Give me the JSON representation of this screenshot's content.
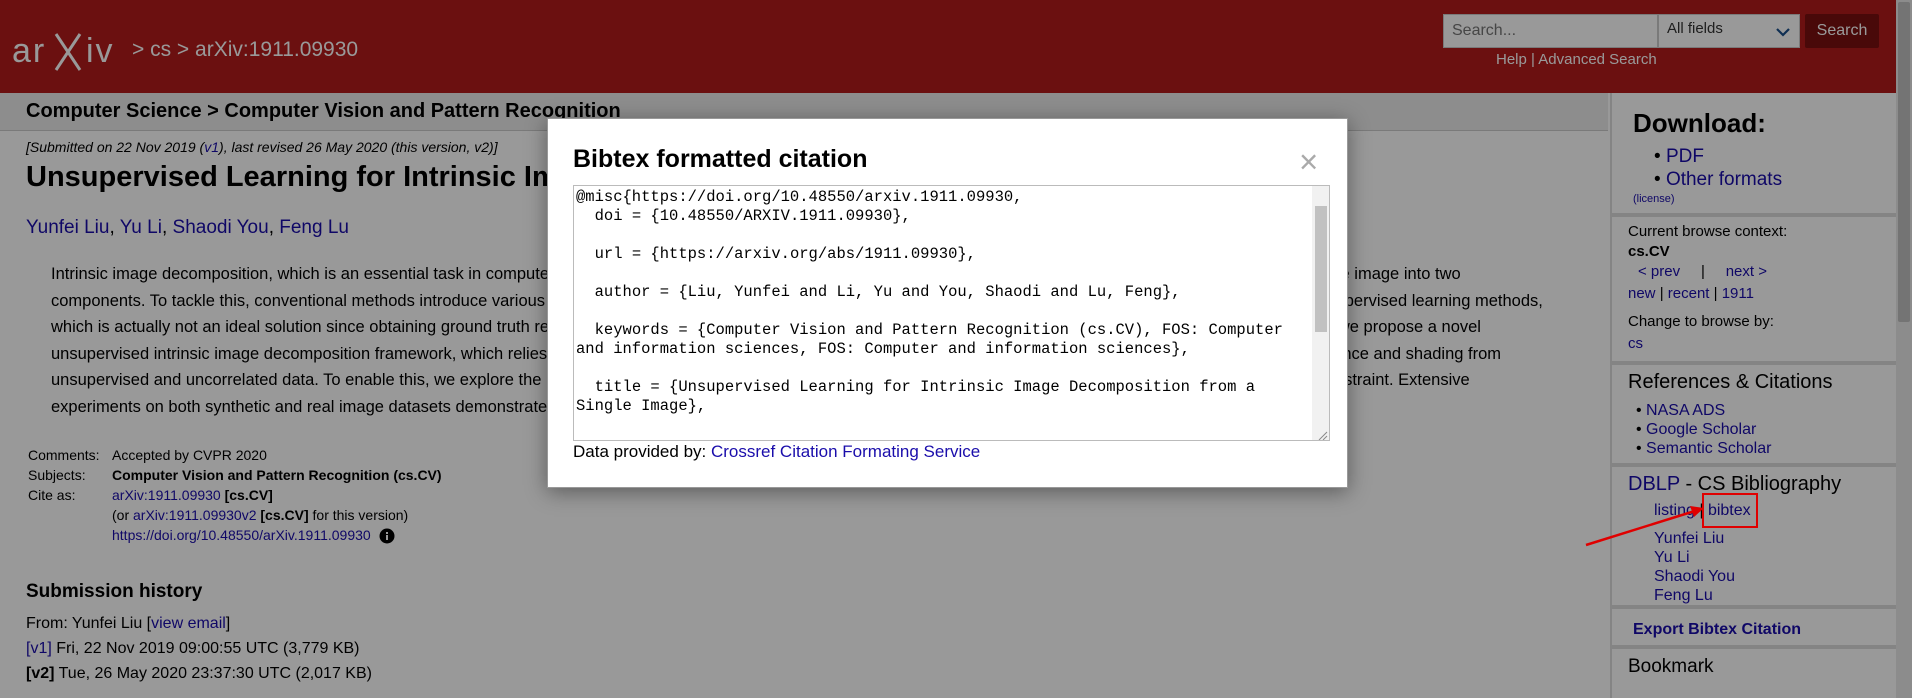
{
  "header": {
    "logo_text": "arXiv",
    "breadcrumb": "> cs > arXiv:1911.09930",
    "search": {
      "placeholder": "Search...",
      "field": "All fields",
      "button": "Search"
    },
    "links": {
      "help": "Help",
      "sep": "|",
      "advanced": "Advanced Search"
    }
  },
  "main": {
    "subject_heading": "Computer Science > Computer Vision and Pattern Recognition",
    "dateline": {
      "pre": "[Submitted on 22 Nov 2019 (",
      "v1": "v1",
      "post": "), last revised 26 May 2020 (this version, v2)]"
    },
    "title": "Unsupervised Learning for Intrinsic Image Decomposition from a Single Image",
    "authors": [
      "Yunfei Liu",
      "Yu Li",
      "Shaodi You",
      "Feng Lu"
    ],
    "author_sep": ", ",
    "abstract": "Intrinsic image decomposition, which is an essential task in computer vision, aims to infer the reflectance and shading of the scene. It is challenging since it needs to separate one image into two components. To tackle this, conventional methods introduce various priors to constrain the solution, yet with limited performance. Meanwhile, the problem is typically solved by supervised learning methods, which is actually not an ideal solution since obtaining ground truth reflectance and shading for massive general natural scenes is challenging and even impossible. In this paper, we propose a novel unsupervised intrinsic image decomposition framework, which relies on neither labeled training data nor hand-crafted priors. Instead, it directly learns the latent feature of reflectance and shading from unsupervised and uncorrelated data. To enable this, we explore the independence between reflectance and shading, the domain invariant content constraint and the physical constraint. Extensive experiments on both synthetic and real image datasets demonstrate consistently superior performance of the proposed method.",
    "meta": {
      "comments_key": "Comments:",
      "comments": "Accepted by CVPR 2020",
      "subjects_key": "Subjects:",
      "subjects": "Computer Vision and Pattern Recognition (cs.CV)",
      "cite_key": "Cite as:",
      "cite_id": "arXiv:1911.09930",
      "cite_cat": "[cs.CV]",
      "cite2_pre": "(or ",
      "cite2_id": "arXiv:1911.09930v2",
      "cite2_cat": "[cs.CV]",
      "cite2_post": " for this version)",
      "doi": "https://doi.org/10.48550/arXiv.1911.09930"
    },
    "history": {
      "title": "Submission history",
      "from_pre": "From: Yunfei Liu [",
      "view_email": "view email",
      "from_post": "]",
      "v1_label": "[v1]",
      "v1_text": " Fri, 22 Nov 2019 09:00:55 UTC (3,779 KB)",
      "v2_label": "[v2]",
      "v2_text": " Tue, 26 May 2020 23:37:30 UTC (2,017 KB)"
    }
  },
  "sidebar": {
    "download_title": "Download:",
    "downloads": [
      "PDF",
      "Other formats"
    ],
    "license": "(license)",
    "browse_context_label": "Current browse context:",
    "browse_context": "cs.CV",
    "prev": "< prev",
    "nav_sep": "|",
    "next": "next >",
    "new": "new",
    "recent": "recent",
    "year": "1911",
    "change_label": "Change to browse by:",
    "change_cat": "cs",
    "refs_title": "References & Citations",
    "refs": [
      "NASA ADS",
      "Google Scholar",
      "Semantic Scholar"
    ],
    "dblp_title": "DBLP",
    "dblp_suffix": " - CS Bibliography",
    "dblp_listing": "listing",
    "dblp_sep": " | ",
    "dblp_bibtex": "bibtex",
    "dblp_authors": [
      "Yunfei Liu",
      "Yu Li",
      "Shaodi You",
      "Feng Lu"
    ],
    "export_bibtex": "Export Bibtex Citation",
    "bookmark_title": "Bookmark"
  },
  "modal": {
    "title": "Bibtex formatted citation",
    "close": "×",
    "bibtex": "@misc{https://doi.org/10.48550/arxiv.1911.09930,\n  doi = {10.48550/ARXIV.1911.09930},\n\n  url = {https://arxiv.org/abs/1911.09930},\n\n  author = {Liu, Yunfei and Li, Yu and You, Shaodi and Lu, Feng},\n\n  keywords = {Computer Vision and Pattern Recognition (cs.CV), FOS: Computer and information sciences, FOS: Computer and information sciences},\n\n  title = {Unsupervised Learning for Intrinsic Image Decomposition from a Single Image},",
    "provided_label": "Data provided by: ",
    "provided_link": "Crossref Citation Formating Service"
  },
  "colors": {
    "header_bg": "#b31b1b",
    "link": "#1a0dab",
    "annotation": "#e00000"
  }
}
